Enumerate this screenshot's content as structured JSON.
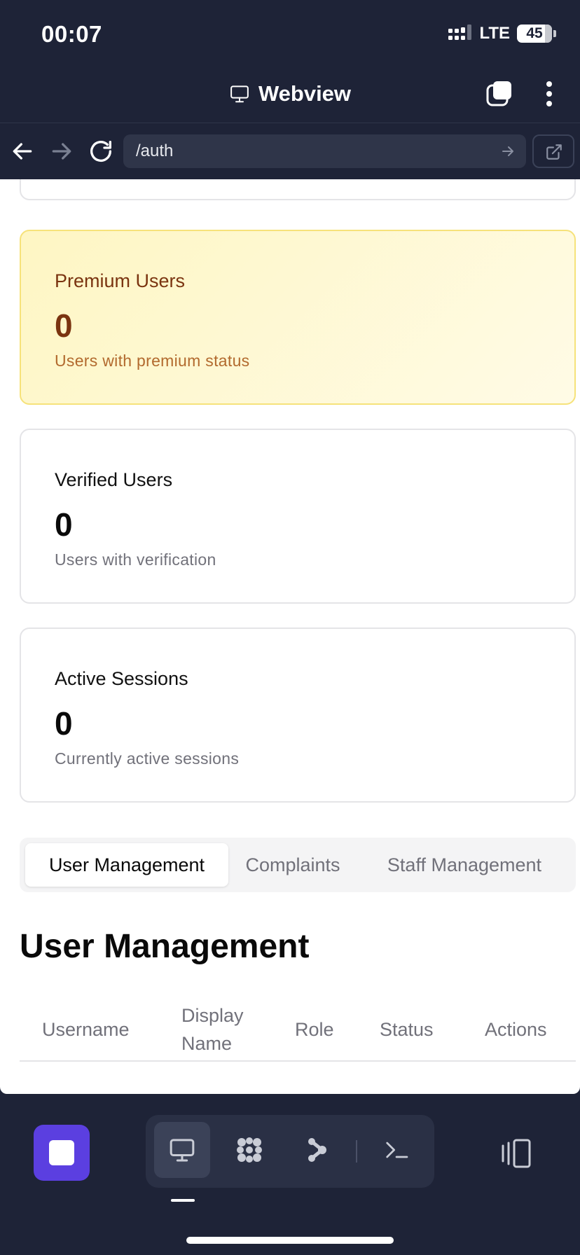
{
  "status_bar": {
    "time": "00:07",
    "network": "LTE",
    "battery": "45"
  },
  "title_bar": {
    "title": "Webview"
  },
  "url_bar": {
    "url": "/auth"
  },
  "cards": {
    "premium": {
      "title": "Premium Users",
      "value": "0",
      "description": "Users with premium status"
    },
    "verified": {
      "title": "Verified Users",
      "value": "0",
      "description": "Users with verification"
    },
    "sessions": {
      "title": "Active Sessions",
      "value": "0",
      "description": "Currently active sessions"
    }
  },
  "tabs": [
    {
      "label": "User Management",
      "active": true
    },
    {
      "label": "Complaints",
      "active": false
    },
    {
      "label": "Staff Management",
      "active": false
    }
  ],
  "section": {
    "heading": "User Management"
  },
  "table": {
    "columns": [
      "Username",
      "Display",
      "Name",
      "Role",
      "Status",
      "Actions"
    ]
  },
  "colors": {
    "accent": "#5b3fe0",
    "background": "#1e2337",
    "premium_text": "#7a3410"
  }
}
